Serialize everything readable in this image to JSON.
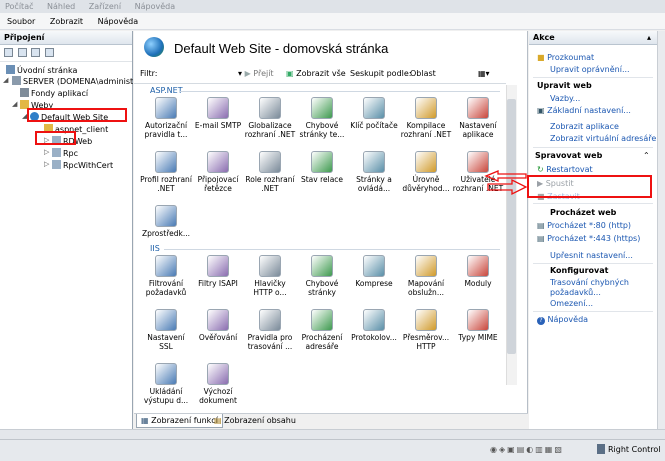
{
  "topmenu": [
    "Počítač",
    "Náhled",
    "Zařízení",
    "Nápověda"
  ],
  "menubar": [
    "Soubor",
    "Zobrazit",
    "Nápověda"
  ],
  "left": {
    "header": "Připojení",
    "tree": [
      {
        "label": "Úvodní stránka"
      },
      {
        "label": "SERVER (DOMENA\\administ"
      },
      {
        "label": "Fondy aplikací"
      },
      {
        "label": "Weby"
      },
      {
        "label": "Default Web Site"
      },
      {
        "label": "aspnet_client"
      },
      {
        "label": "RDWeb"
      },
      {
        "label": "Rpc"
      },
      {
        "label": "RpcWithCert"
      }
    ]
  },
  "center": {
    "title": "Default Web Site - domovská stránka",
    "filter_label": "Filtr:",
    "go_label": "Přejít",
    "show_all_label": "Zobrazit vše",
    "group_by_label": "Seskupit podle:",
    "group_by_value": "Oblast",
    "group1": "ASP.NET",
    "group2": "IIS",
    "aspnet": [
      "Autorizační pravidla t...",
      "E-mail SMTP",
      "Globalizace rozhraní .NET",
      "Chybové stránky te...",
      "Klíč počítače",
      "Kompilace rozhraní .NET",
      "Nastavení aplikace",
      "Profil rozhraní .NET",
      "Připojovací řetězce",
      "Role rozhraní .NET",
      "Stav relace",
      "Stránky a ovládá...",
      "Úrovně důvěryhod...",
      "Uživatelé rozhraní .NET",
      "Zprostředk..."
    ],
    "iis": [
      "Filtrování požadavků",
      "Filtry ISAPI",
      "Hlavičky HTTP o...",
      "Chybové stránky",
      "Komprese",
      "Mapování obslužn...",
      "Moduly",
      "Nastavení SSL",
      "Ověřování",
      "Pravidla pro trasování ...",
      "Procházení adresáře",
      "Protokolov...",
      "Přesměrov... HTTP",
      "Typy MIME",
      "Ukládání výstupu d...",
      "Výchozí dokument"
    ],
    "tab_features": "Zobrazení funkcí",
    "tab_content": "Zobrazení obsahu"
  },
  "right": {
    "header": "Akce",
    "explore": "Prozkoumat",
    "edit_perms": "Upravit oprávnění...",
    "edit_site_h": "Upravit web",
    "bindings": "Vazby...",
    "basic": "Základní nastavení...",
    "view_apps": "Zobrazit aplikace",
    "view_vdirs": "Zobrazit virtuální adresáře",
    "manage_h": "Spravovat web",
    "restart": "Restartovat",
    "start": "Spustit",
    "stop": "Zastavit",
    "browse_h": "Procházet web",
    "browse80": "Procházet *:80 (http)",
    "browse443": "Procházet *:443 (https)",
    "advanced": "Upřesnit nastavení...",
    "configure_h": "Konfigurovat",
    "failed_req": "Trasování chybných požadavků...",
    "limits": "Omezení...",
    "help": "Nápověda"
  },
  "taskbar": {
    "right_control": "Right Control"
  },
  "colors": {
    "link": "#1b57b1",
    "annotation": "#e11111",
    "group": "#1d5fa8"
  }
}
